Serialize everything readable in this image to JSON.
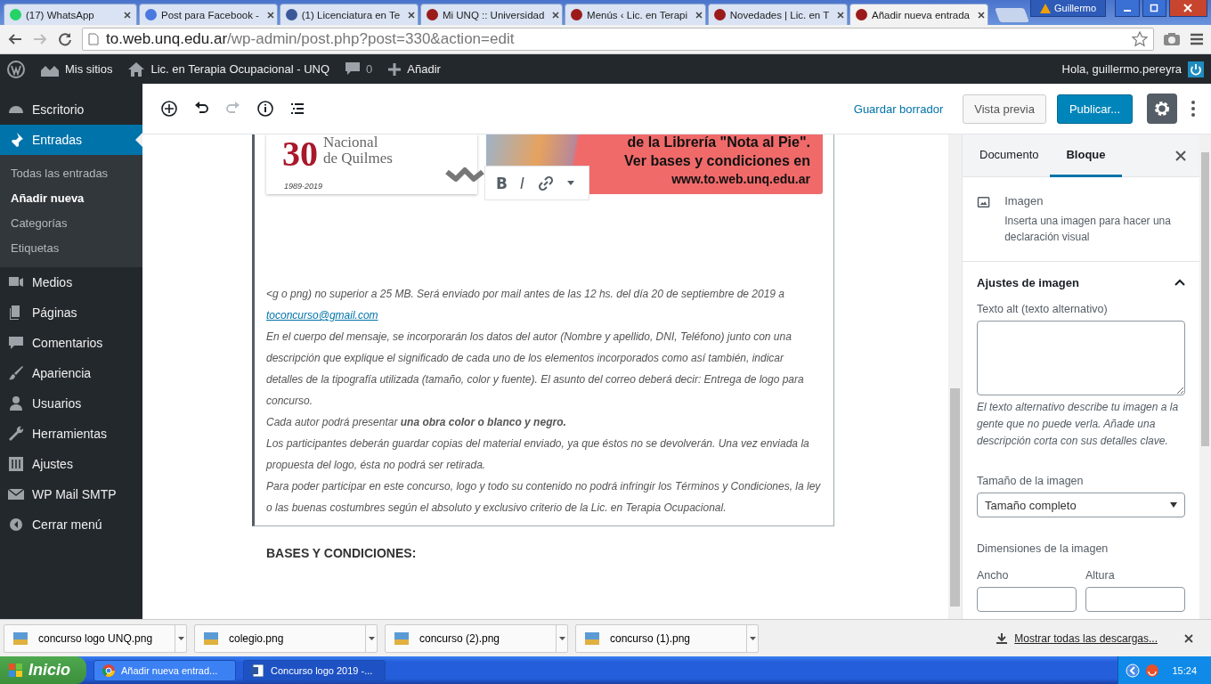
{
  "browser": {
    "tabs": [
      {
        "title": "(17) WhatsApp",
        "selected": false
      },
      {
        "title": "Post para Facebook -",
        "selected": false
      },
      {
        "title": "(1) Licenciatura en Te",
        "selected": false
      },
      {
        "title": "Mi UNQ :: Universidad",
        "selected": false
      },
      {
        "title": "Menús ‹ Lic. en Terapi",
        "selected": false
      },
      {
        "title": "Novedades | Lic. en T",
        "selected": false
      },
      {
        "title": "Añadir nueva entrada",
        "selected": true
      }
    ],
    "user": "Guillermo",
    "address": {
      "host": "to.web.unq.edu.ar",
      "path": "/wp-admin/post.php?post=330&action=edit"
    }
  },
  "admin_bar": {
    "sites": "Mis sitios",
    "site": "Lic. en Terapia Ocupacional - UNQ",
    "comments": "0",
    "new": "Añadir",
    "greeting": "Hola, guillermo.pereyra"
  },
  "menu": [
    {
      "label": "Escritorio",
      "selected": false
    },
    {
      "label": "Entradas",
      "selected": true,
      "children": [
        {
          "label": "Todas las entradas",
          "selected": false
        },
        {
          "label": "Añadir nueva",
          "selected": true
        },
        {
          "label": "Categorías",
          "selected": false
        },
        {
          "label": "Etiquetas",
          "selected": false
        }
      ]
    },
    {
      "label": "Medios",
      "selected": false
    },
    {
      "label": "Páginas",
      "selected": false
    },
    {
      "label": "Comentarios",
      "selected": false
    },
    {
      "label": "Apariencia",
      "selected": false
    },
    {
      "label": "Usuarios",
      "selected": false
    },
    {
      "label": "Herramientas",
      "selected": false
    },
    {
      "label": "Ajustes",
      "selected": false
    },
    {
      "label": "WP Mail SMTP",
      "selected": false
    },
    {
      "label": "Cerrar menú",
      "selected": false
    }
  ],
  "editor_toolbar": {
    "tools": [
      {
        "disabled": false
      },
      {
        "disabled": false
      },
      {
        "disabled": true
      },
      {
        "disabled": false
      },
      {
        "disabled": false
      }
    ],
    "save_draft": "Guardar borrador",
    "preview": "Vista previa",
    "publish": "Publicar...",
    "settings": {
      "selected": true
    }
  },
  "image": {
    "logo_number": "30",
    "logo_lines": [
      "Nacional",
      "de Quilmes"
    ],
    "logo_years": "1989-2019",
    "banner_lines": [
      "de la Librería \"Nota al Pie\".",
      "Ver bases y condiciones en",
      "www.to.web.unq.edu.ar"
    ]
  },
  "format_toolbar": {
    "bold": "B",
    "italic": "I"
  },
  "paragraphs": [
    {
      "text": "<g o png) no superior a 25 MB. Será enviado por mail antes de las 12 hs. del día 20 de septiembre de 2019 a",
      "link": "toconcurso@gmail.com"
    },
    {
      "text": "En el cuerpo del mensaje, se incorporarán los datos del autor (Nombre y apellido, DNI, Teléfono) junto con una descripción que explique el significado de cada uno de los elementos incorporados como así también, indicar detalles de la tipografía utilizada (tamaño, color y fuente). El asunto del correo deberá decir: Entrega de logo para concurso."
    },
    {
      "text": "Cada autor podrá presentar **una obra color o blanco y negro.**"
    },
    {
      "text": "Los participantes deberán guardar copias del material enviado, ya que éstos no se devolverán. Una vez enviada la propuesta del logo, ésta no podrá ser retirada."
    },
    {
      "text": "Para poder participar en este concurso, logo y todo su contenido no podrá infringir los Términos y Condiciones, la ley o las buenas costumbres según el absoluto y exclusivo criterio de la Lic. en Terapia Ocupacional."
    }
  ],
  "heading": "BASES Y CONDICIONES:",
  "panel": {
    "tabs": [
      {
        "label": "Documento",
        "selected": false
      },
      {
        "label": "Bloque",
        "selected": true
      }
    ],
    "block": {
      "name": "Imagen",
      "description": "Inserta una imagen para hacer una declaración visual"
    },
    "section": {
      "title": "Ajustes de imagen",
      "expanded": true
    },
    "alt_label": "Texto alt (texto alternativo)",
    "alt_help": "El texto alternativo describe tu imagen a la gente que no puede verla. Añade una descripción corta con sus detalles clave.",
    "size_label": "Tamaño de la imagen",
    "size_value": "Tamaño completo",
    "dimensions_label": "Dimensiones de la imagen",
    "width_label": "Ancho",
    "height_label": "Altura"
  },
  "downloads": [
    {
      "name": "concurso logo UNQ.png"
    },
    {
      "name": "colegio.png"
    },
    {
      "name": "concurso (2).png"
    },
    {
      "name": "concurso (1).png"
    }
  ],
  "show_all": "Mostrar todas las descargas...",
  "taskbar": {
    "start": "Inicio",
    "tasks": [
      {
        "title": "Añadir nueva entrad...",
        "selected": false
      },
      {
        "title": "Concurso logo 2019 -...",
        "selected": true
      }
    ],
    "clock": "15:24"
  }
}
